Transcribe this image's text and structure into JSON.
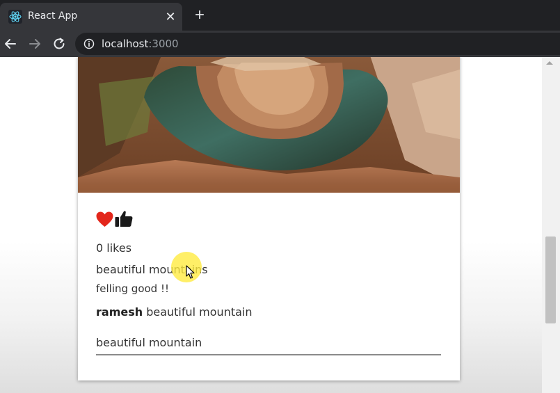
{
  "browser": {
    "tab": {
      "title": "React App",
      "close_label": "✕"
    },
    "new_tab_label": "+",
    "address": {
      "host": "localhost",
      "port": ":3000"
    }
  },
  "post": {
    "likes": "0 likes",
    "caption": "beautiful mountains",
    "mood": "felling good !!",
    "comments": [
      {
        "user": "ramesh",
        "text": " beautiful mountain"
      }
    ],
    "comment_input_value": "beautiful mountain"
  },
  "colors": {
    "heart": "#e3261b",
    "like": "#1a1a1a",
    "chrome_dark": "#202124",
    "chrome_mid": "#35363a",
    "cursor_highlight": "#ffea3c"
  },
  "icons": [
    "react-logo-icon",
    "close-icon",
    "plus-icon",
    "back-arrow-icon",
    "forward-arrow-icon",
    "reload-icon",
    "info-icon",
    "heart-icon",
    "thumbs-up-icon"
  ]
}
